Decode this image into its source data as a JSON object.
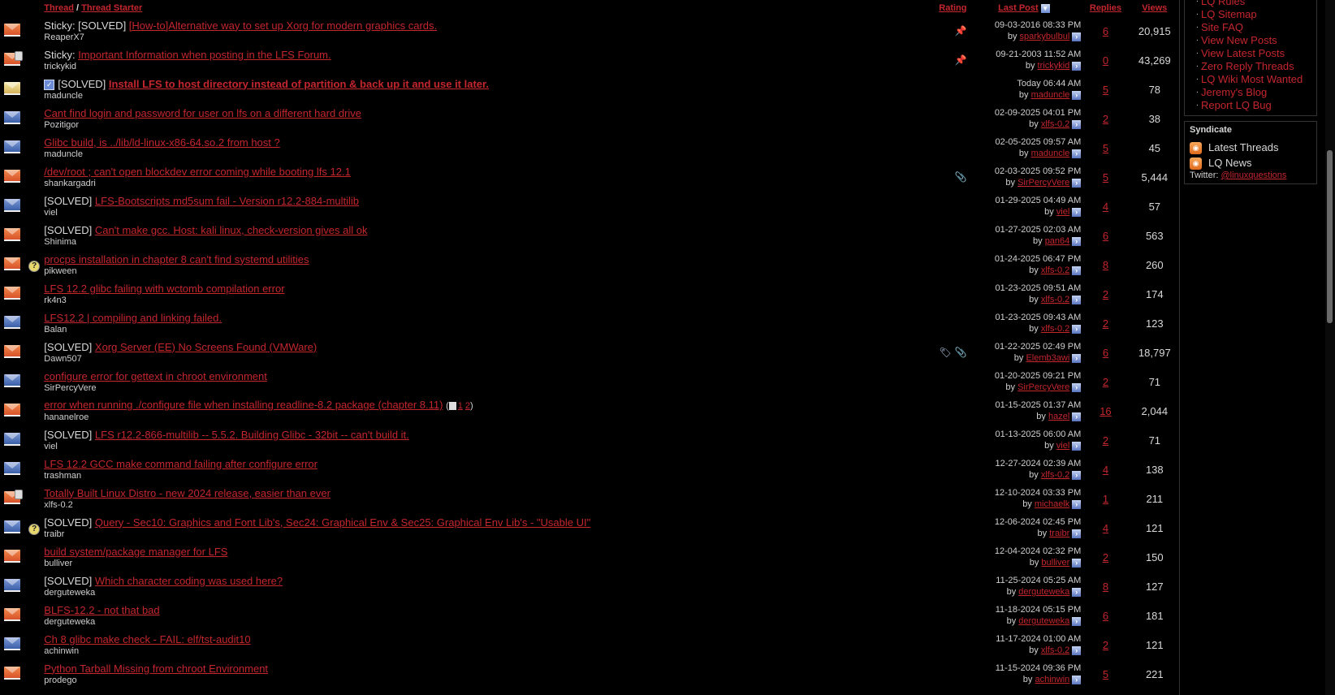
{
  "header": {
    "thread": "Thread",
    "separator": " / ",
    "thread_starter": "Thread Starter",
    "rating": "Rating",
    "last_post": "Last Post",
    "replies": "Replies",
    "views": "Views"
  },
  "threads": [
    {
      "status": "orange",
      "icon": "",
      "prefix": "Sticky: [SOLVED] ",
      "title": "[How-to]Alternative way to set up Xorg for modern graphics cards.",
      "bold": false,
      "starter": "ReaperX7",
      "flags": "pin",
      "date": "09-03-2016 08:33 PM",
      "by": "by",
      "last_user": "sparkybulbul",
      "replies": "6",
      "views": "20,915"
    },
    {
      "status": "orange-lock",
      "icon": "",
      "prefix": "Sticky: ",
      "title": "Important Information when posting in the LFS Forum.",
      "bold": false,
      "starter": "trickykid",
      "flags": "pin",
      "date": "09-21-2003 11:52 AM",
      "by": "by",
      "last_user": "trickykid",
      "replies": "0",
      "views": "43,269"
    },
    {
      "status": "yellow",
      "icon": "check",
      "prefix": "[SOLVED] ",
      "title": "Install LFS to host directory instead of partition & back up it and use it later.",
      "bold": true,
      "starter": "maduncle",
      "flags": "",
      "date": "Today 06:44 AM",
      "by": "by",
      "last_user": "maduncle",
      "replies": "5",
      "views": "78"
    },
    {
      "status": "blue",
      "icon": "",
      "prefix": "",
      "title": "Cant find login and password for user on lfs on a different hard drive",
      "bold": false,
      "starter": "Pozitigor",
      "flags": "",
      "date": "02-09-2025 04:01 PM",
      "by": "by",
      "last_user": "xlfs-0.2",
      "replies": "2",
      "views": "38"
    },
    {
      "status": "blue",
      "icon": "",
      "prefix": "",
      "title": "Glibc build, is ../lib/ld-linux-x86-64.so.2 from host ?",
      "bold": false,
      "starter": "maduncle",
      "flags": "",
      "date": "02-05-2025 09:57 AM",
      "by": "by",
      "last_user": "maduncle",
      "replies": "5",
      "views": "45"
    },
    {
      "status": "orange",
      "icon": "",
      "prefix": "",
      "title": "/dev/root ; can't open blockdev error coming while booting lfs 12.1",
      "bold": false,
      "starter": "shankargadri",
      "flags": "clip",
      "date": "02-03-2025 09:52 PM",
      "by": "by",
      "last_user": "SirPercyVere",
      "replies": "5",
      "views": "5,444"
    },
    {
      "status": "blue",
      "icon": "",
      "prefix": "[SOLVED] ",
      "title": "LFS-Bootscripts md5sum fail - Version r12.2-884-multilib",
      "bold": false,
      "starter": "viel",
      "flags": "",
      "date": "01-29-2025 04:49 AM",
      "by": "by",
      "last_user": "viel",
      "replies": "4",
      "views": "57"
    },
    {
      "status": "orange",
      "icon": "",
      "prefix": "[SOLVED] ",
      "title": "Can't make gcc. Host: kali linux, check-version gives all ok",
      "bold": false,
      "starter": "Shinima",
      "flags": "",
      "date": "01-27-2025 02:03 AM",
      "by": "by",
      "last_user": "pan64",
      "replies": "6",
      "views": "563"
    },
    {
      "status": "orange",
      "icon": "question",
      "prefix": "",
      "title": "procps installation in chapter 8 can't find systemd utilities",
      "bold": false,
      "starter": "pikween",
      "flags": "",
      "date": "01-24-2025 06:47 PM",
      "by": "by",
      "last_user": "xlfs-0.2",
      "replies": "8",
      "views": "260"
    },
    {
      "status": "orange",
      "icon": "",
      "prefix": "",
      "title": "LFS 12.2 glibc failing with wctomb compilation error",
      "bold": false,
      "starter": "rk4n3",
      "flags": "",
      "date": "01-23-2025 09:51 AM",
      "by": "by",
      "last_user": "xlfs-0.2",
      "replies": "2",
      "views": "174"
    },
    {
      "status": "blue",
      "icon": "",
      "prefix": "",
      "title": "LFS12.2 | compiling and linking failed.",
      "bold": false,
      "starter": "Balan",
      "flags": "",
      "date": "01-23-2025 09:43 AM",
      "by": "by",
      "last_user": "xlfs-0.2",
      "replies": "2",
      "views": "123"
    },
    {
      "status": "orange",
      "icon": "",
      "prefix": "[SOLVED] ",
      "title": "Xorg Server (EE) No Screens Found (VMWare)",
      "bold": false,
      "starter": "Dawn507",
      "flags": "tag-clip",
      "date": "01-22-2025 02:49 PM",
      "by": "by",
      "last_user": "Elemb3awi",
      "replies": "6",
      "views": "18,797"
    },
    {
      "status": "blue",
      "icon": "",
      "prefix": "",
      "title": "configure error for gettext in chroot environment",
      "bold": false,
      "starter": "SirPercyVere",
      "flags": "",
      "date": "01-20-2025 09:21 PM",
      "by": "by",
      "last_user": "SirPercyVere",
      "replies": "2",
      "views": "71"
    },
    {
      "status": "orange",
      "icon": "",
      "prefix": "",
      "title": "error when running ./configure file when installing readline-8.2 package (chapter 8.11)",
      "bold": false,
      "starter": "hananelroe",
      "flags": "",
      "pages": [
        "1",
        "2"
      ],
      "date": "01-15-2025 01:37 AM",
      "by": "by",
      "last_user": "hazel",
      "replies": "16",
      "views": "2,044"
    },
    {
      "status": "blue",
      "icon": "",
      "prefix": "[SOLVED] ",
      "title": "LFS r12.2-866-multilib -- 5.5.2. Building Glibc - 32bit -- can't build it.",
      "bold": false,
      "starter": "viel",
      "flags": "",
      "date": "01-13-2025 06:00 AM",
      "by": "by",
      "last_user": "viel",
      "replies": "2",
      "views": "71"
    },
    {
      "status": "blue",
      "icon": "",
      "prefix": "",
      "title": "LFS 12.2 GCC make command failing after configure error",
      "bold": false,
      "starter": "trashman",
      "flags": "",
      "date": "12-27-2024 02:39 AM",
      "by": "by",
      "last_user": "xlfs-0.2",
      "replies": "4",
      "views": "138"
    },
    {
      "status": "orange-lock",
      "icon": "",
      "prefix": "",
      "title": "Totally Built Linux Distro - new 2024 release, easier than ever",
      "bold": false,
      "starter": "xlfs-0.2",
      "flags": "",
      "date": "12-10-2024 03:33 PM",
      "by": "by",
      "last_user": "michaelk",
      "replies": "1",
      "views": "211"
    },
    {
      "status": "blue",
      "icon": "question",
      "prefix": "[SOLVED] ",
      "title": "Query - Sec10: Graphics and Font Lib's, Sec24: Graphical Env & Sec25: Graphical Env Lib's - \"Usable UI\"",
      "bold": false,
      "starter": "traibr",
      "flags": "",
      "date": "12-06-2024 02:45 PM",
      "by": "by",
      "last_user": "traibr",
      "replies": "4",
      "views": "121"
    },
    {
      "status": "orange",
      "icon": "",
      "prefix": "",
      "title": "build system/package manager for LFS",
      "bold": false,
      "starter": "bulliver",
      "flags": "",
      "date": "12-04-2024 02:32 PM",
      "by": "by",
      "last_user": "bulliver",
      "replies": "2",
      "views": "150"
    },
    {
      "status": "blue",
      "icon": "",
      "prefix": "[SOLVED] ",
      "title": "Which character coding was used here?",
      "bold": false,
      "starter": "derguteweka",
      "flags": "",
      "date": "11-25-2024 05:25 AM",
      "by": "by",
      "last_user": "derguteweka",
      "replies": "8",
      "views": "127"
    },
    {
      "status": "orange",
      "icon": "",
      "prefix": "",
      "title": "BLFS-12.2 - not that bad",
      "bold": false,
      "starter": "derguteweka",
      "flags": "",
      "date": "11-18-2024 05:15 PM",
      "by": "by",
      "last_user": "derguteweka",
      "replies": "6",
      "views": "181"
    },
    {
      "status": "blue",
      "icon": "",
      "prefix": "",
      "title": "Ch 8 glibc make check - FAIL: elf/tst-audit10",
      "bold": false,
      "starter": "achinwin",
      "flags": "",
      "date": "11-17-2024 01:00 AM",
      "by": "by",
      "last_user": "xlfs-0.2",
      "replies": "2",
      "views": "121"
    },
    {
      "status": "orange",
      "icon": "",
      "prefix": "",
      "title": "Python Tarball Missing from chroot Environment",
      "bold": false,
      "starter": "prodego",
      "flags": "",
      "date": "11-15-2024 09:36 PM",
      "by": "by",
      "last_user": "achinwin",
      "replies": "5",
      "views": "221"
    }
  ],
  "sidebar": {
    "links": [
      "LQ Rules",
      "LQ Sitemap",
      "Site FAQ",
      "View New Posts",
      "View Latest Posts",
      "Zero Reply Threads",
      "LQ Wiki Most Wanted",
      "Jeremy's Blog",
      "Report LQ Bug"
    ],
    "syndicate": {
      "title": "Syndicate",
      "feeds": [
        "Latest Threads",
        "LQ News"
      ],
      "twitter_label": "Twitter: ",
      "twitter_handle": "@linuxquestions"
    }
  },
  "colors": {
    "link": "#c4262e",
    "background": "#000000",
    "text": "#d8d8d8"
  }
}
